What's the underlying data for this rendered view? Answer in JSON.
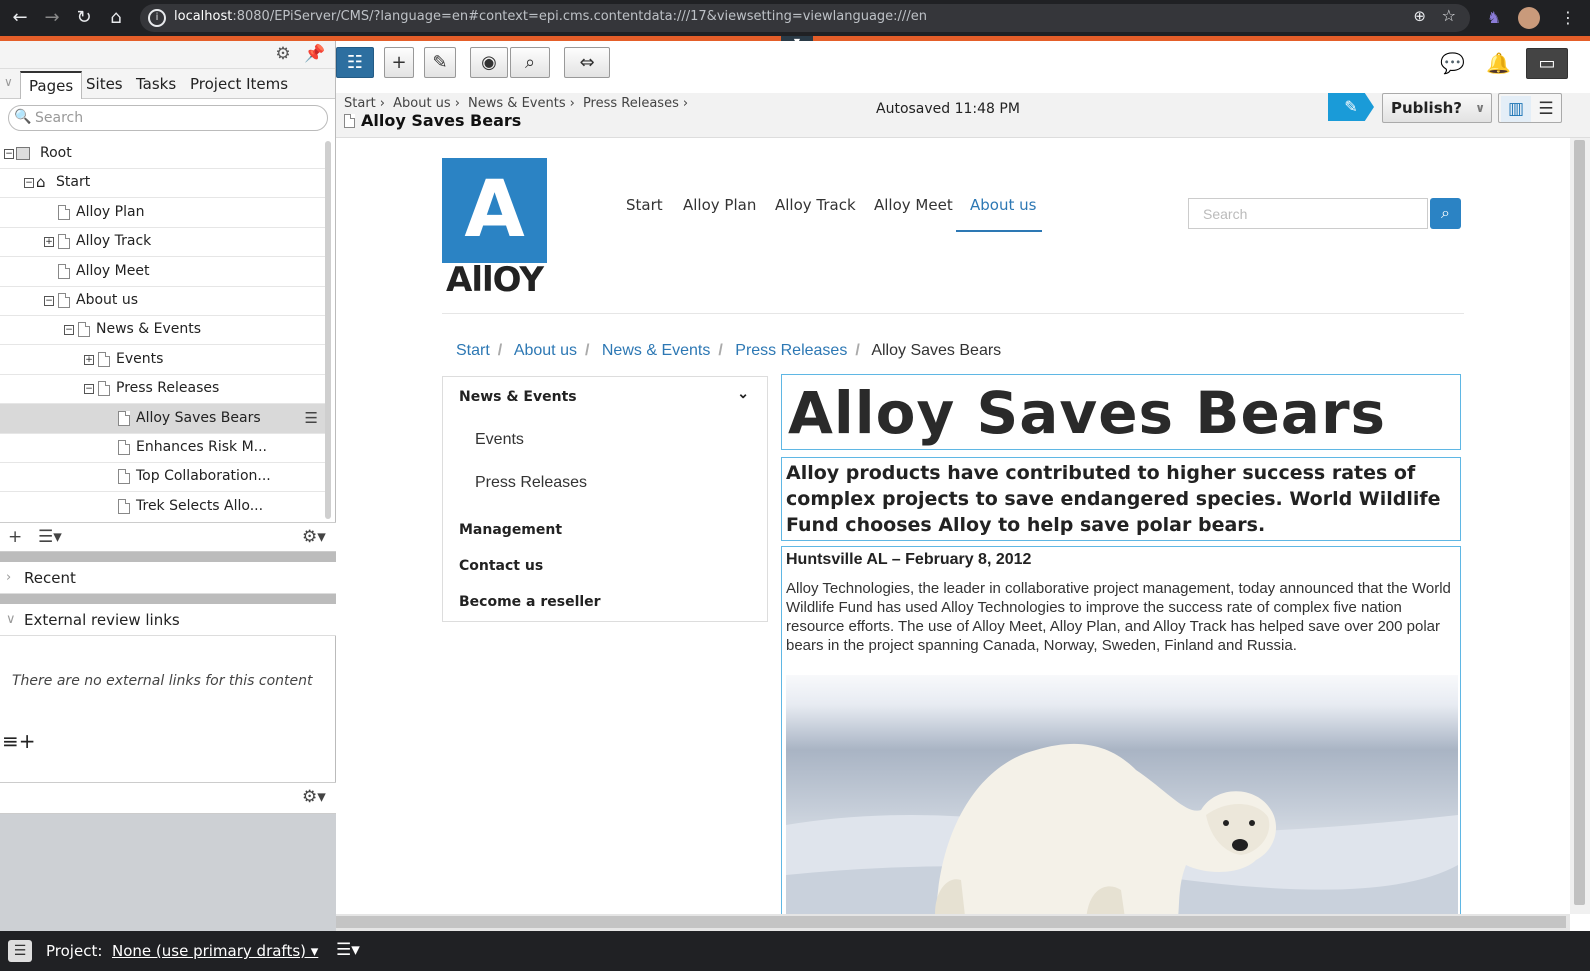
{
  "browser": {
    "url_host": "localhost",
    "url_rest": ":8080/EPiServer/CMS/?language=en#context=epi.cms.contentdata:///17&viewsetting=viewlanguage:///en"
  },
  "nav_tabs": [
    "Pages",
    "Sites",
    "Tasks",
    "Project Items"
  ],
  "tree_search_placeholder": "Search",
  "tree": [
    {
      "label": "Root",
      "indent": 0,
      "toggle": "−",
      "kind": "root"
    },
    {
      "label": "Start",
      "indent": 1,
      "toggle": "−",
      "kind": "home"
    },
    {
      "label": "Alloy Plan",
      "indent": 2,
      "toggle": "",
      "kind": "page"
    },
    {
      "label": "Alloy Track",
      "indent": 2,
      "toggle": "+",
      "kind": "page"
    },
    {
      "label": "Alloy Meet",
      "indent": 2,
      "toggle": "",
      "kind": "page"
    },
    {
      "label": "About us",
      "indent": 2,
      "toggle": "−",
      "kind": "page"
    },
    {
      "label": "News & Events",
      "indent": 3,
      "toggle": "−",
      "kind": "page"
    },
    {
      "label": "Events",
      "indent": 4,
      "toggle": "+",
      "kind": "page"
    },
    {
      "label": "Press Releases",
      "indent": 4,
      "toggle": "−",
      "kind": "page"
    },
    {
      "label": "Alloy Saves Bears",
      "indent": 5,
      "toggle": "",
      "kind": "page",
      "selected": true
    },
    {
      "label": "Enhances Risk M...",
      "indent": 5,
      "toggle": "",
      "kind": "page"
    },
    {
      "label": "Top Collaboration...",
      "indent": 5,
      "toggle": "",
      "kind": "page"
    },
    {
      "label": "Trek Selects Allo...",
      "indent": 5,
      "toggle": "",
      "kind": "page"
    }
  ],
  "recent_label": "Recent",
  "external_links_label": "External review links",
  "no_external_links": "There are no external links for this content",
  "project": {
    "label": "Project:",
    "value": "None (use primary drafts)"
  },
  "context": {
    "breadcrumb": [
      "Start",
      "About us",
      "News & Events",
      "Press Releases"
    ],
    "title": "Alloy Saves Bears",
    "autosave": "Autosaved 11:48 PM",
    "publish_label": "Publish?"
  },
  "site": {
    "logo_letter": "A",
    "logo_word": "AllOY",
    "nav": [
      "Start",
      "Alloy Plan",
      "Alloy Track",
      "Alloy Meet",
      "About us"
    ],
    "search_placeholder": "Search",
    "breadcrumb": [
      "Start",
      "About us",
      "News & Events",
      "Press Releases"
    ],
    "breadcrumb_current": "Alloy Saves Bears",
    "subnav": {
      "heading": "News & Events",
      "items": [
        "Events",
        "Press Releases"
      ],
      "bold_items": [
        "Management",
        "Contact us",
        "Become a reseller"
      ]
    },
    "heading": "Alloy Saves Bears",
    "intro": "Alloy products have contributed to higher success rates of complex projects to save endangered species. World Wildlife Fund chooses Alloy to help save polar bears.",
    "dateline": "Huntsville AL – February 8, 2012",
    "body": "Alloy Technologies, the leader in collaborative project management, today announced that the World Wildlife Fund has used Alloy Technologies to improve the success rate of complex five nation resource efforts. The use of Alloy Meet, Alloy Plan, and Alloy Track has helped save over 200 polar bears in the project spanning Canada, Norway, Sweden, Finland and Russia."
  },
  "colors": {
    "accent": "#2d78b4",
    "chrome_bar": "#e45e29",
    "edit_blue": "#1a9bd8",
    "logo_blue": "#2b83c4"
  }
}
